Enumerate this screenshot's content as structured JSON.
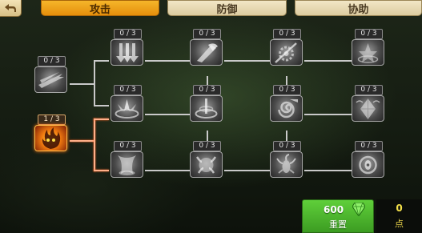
{
  "tabs": [
    {
      "label": "攻击",
      "active": true
    },
    {
      "label": "防御",
      "active": false
    },
    {
      "label": "协助",
      "active": false
    }
  ],
  "nodes": [
    {
      "level": "0 / 3",
      "icon": "wind-slash-icon"
    },
    {
      "level": "1 / 3",
      "icon": "flame-demon-icon"
    },
    {
      "level": "0 / 3",
      "icon": "triple-arrow-icon"
    },
    {
      "level": "0 / 3",
      "icon": "lotus-burst-icon"
    },
    {
      "level": "0 / 3",
      "icon": "vortex-icon"
    },
    {
      "level": "0 / 3",
      "icon": "axe-blade-icon"
    },
    {
      "level": "0 / 3",
      "icon": "whirlwind-icon"
    },
    {
      "level": "0 / 3",
      "icon": "claw-grip-icon"
    },
    {
      "level": "0 / 3",
      "icon": "gear-slash-icon"
    },
    {
      "level": "0 / 3",
      "icon": "spiral-strike-icon"
    },
    {
      "level": "0 / 3",
      "icon": "scorpion-icon"
    },
    {
      "level": "0 / 3",
      "icon": "mystic-circle-icon"
    },
    {
      "level": "0 / 3",
      "icon": "diamond-shard-icon"
    },
    {
      "level": "0 / 3",
      "icon": "eye-ring-icon"
    }
  ],
  "reset": {
    "cost": "600",
    "label": "重置"
  },
  "points": {
    "value": "0",
    "label": "点"
  },
  "colors": {
    "active_tab": "#f0a21e",
    "lit_line": "#ffb08a",
    "reset_green": "#4cb42c",
    "points_yellow": "#f6e24a"
  }
}
